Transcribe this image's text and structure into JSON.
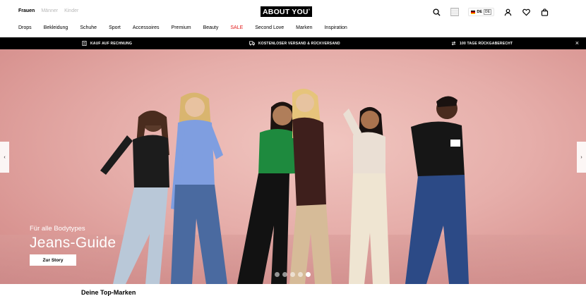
{
  "gender_tabs": [
    "Frauen",
    "Männer",
    "Kinder"
  ],
  "logo": {
    "text": "ABOUT YOU",
    "mark": "°"
  },
  "header_icons": {
    "search": "search-icon",
    "grid": "grid-icon",
    "lang": {
      "flag": "DE",
      "code": "DE"
    },
    "account": "user-icon",
    "wishlist": "heart-icon",
    "basket": "bag-icon"
  },
  "nav": [
    "Drops",
    "Bekleidung",
    "Schuhe",
    "Sport",
    "Accessoires",
    "Premium",
    "Beauty",
    "SALE",
    "Second Love",
    "Marken",
    "Inspiration"
  ],
  "promo": [
    {
      "icon": "invoice-icon",
      "label": "KAUF AUF RECHNUNG"
    },
    {
      "icon": "delivery-icon",
      "label": "KOSTENLOSER VERSAND & RÜCKVERSAND"
    },
    {
      "icon": "return-icon",
      "label": "100 TAGE RÜCKGABERECHT"
    }
  ],
  "promo_close": "×",
  "hero": {
    "kicker": "Für alle Bodytypes",
    "title": "Jeans-Guide",
    "cta": "Zur Story",
    "prev": "‹",
    "next": "›",
    "slide_count": 5,
    "active_slide": 5
  },
  "below_heading": "Deine Top-Marken",
  "colors": {
    "sale": "#e21b1b",
    "promo_bg": "#000000"
  }
}
